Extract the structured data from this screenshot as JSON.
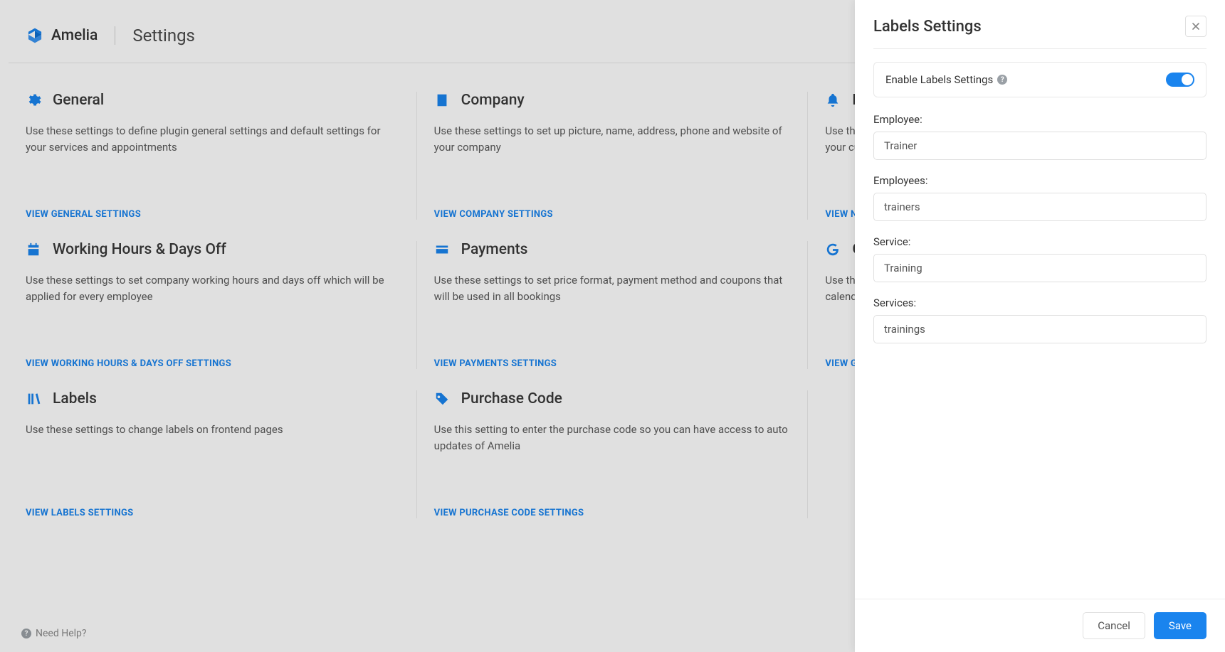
{
  "app": {
    "name": "Amelia",
    "title": "Settings"
  },
  "cards": [
    {
      "icon": "gear",
      "title": "General",
      "desc": "Use these settings to define plugin general settings and default settings for your services and appointments",
      "link": "VIEW GENERAL SETTINGS"
    },
    {
      "icon": "building",
      "title": "Company",
      "desc": "Use these settings to set up picture, name, address, phone and website of your company",
      "link": "VIEW COMPANY SETTINGS"
    },
    {
      "icon": "bell",
      "title": "Notifications",
      "desc": "Use these settings to set your mail settings which will be used to notify your customers and employees",
      "link": "VIEW NOTIFICATIONS SETTINGS"
    },
    {
      "icon": "calendar",
      "title": "Working Hours & Days Off",
      "desc": "Use these settings to set company working hours and days off which will be applied for every employee",
      "link": "VIEW WORKING HOURS & DAYS OFF SETTINGS"
    },
    {
      "icon": "card",
      "title": "Payments",
      "desc": "Use these settings to set price format, payment method and coupons that will be used in all bookings",
      "link": "VIEW PAYMENTS SETTINGS"
    },
    {
      "icon": "google",
      "title": "Google Calendar",
      "desc": "Use these settings to sync your appointments with your employees Google calendar",
      "link": "VIEW GOOGLE CALENDAR SETTINGS"
    },
    {
      "icon": "books",
      "title": "Labels",
      "desc": "Use these settings to change labels on frontend pages",
      "link": "VIEW LABELS SETTINGS"
    },
    {
      "icon": "tag",
      "title": "Purchase Code",
      "desc": "Use this setting to enter the purchase code so you can have access to auto updates of Amelia",
      "link": "VIEW PURCHASE CODE SETTINGS"
    }
  ],
  "footer": {
    "help": "Need Help?"
  },
  "drawer": {
    "title": "Labels Settings",
    "enable_label": "Enable Labels Settings",
    "enabled": true,
    "fields": [
      {
        "label": "Employee:",
        "value": "Trainer"
      },
      {
        "label": "Employees:",
        "value": "trainers"
      },
      {
        "label": "Service:",
        "value": "Training"
      },
      {
        "label": "Services:",
        "value": "trainings"
      }
    ],
    "cancel": "Cancel",
    "save": "Save"
  }
}
